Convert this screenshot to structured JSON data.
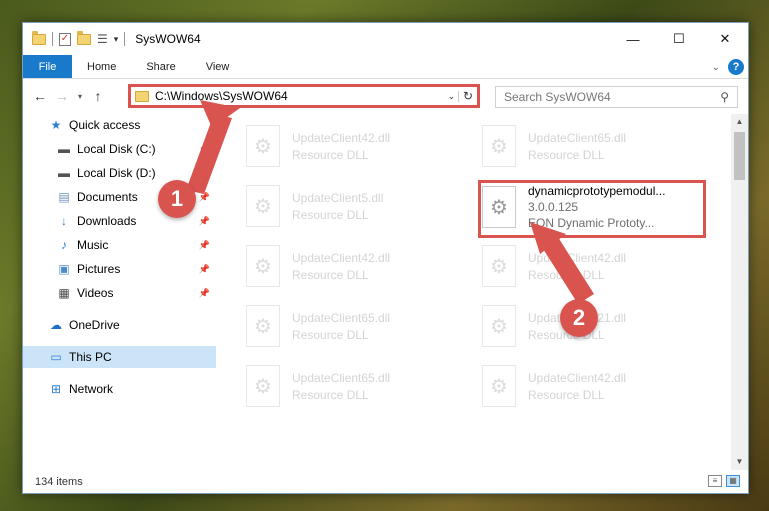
{
  "window": {
    "title": "SysWOW64",
    "controls": {
      "minimize": "—",
      "maximize": "☐",
      "close": "✕"
    }
  },
  "ribbon": {
    "tabs": [
      "File",
      "Home",
      "Share",
      "View"
    ]
  },
  "nav": {
    "address": "C:\\Windows\\SysWOW64",
    "search_placeholder": "Search SysWOW64"
  },
  "sidebar": {
    "items": [
      {
        "label": "Quick access",
        "icon": "star-icon"
      },
      {
        "label": "Local Disk (C:)",
        "icon": "drive-icon",
        "pinned": true
      },
      {
        "label": "Local Disk (D:)",
        "icon": "drive-icon",
        "pinned": true
      },
      {
        "label": "Documents",
        "icon": "documents-icon",
        "pinned": true
      },
      {
        "label": "Downloads",
        "icon": "download-icon",
        "pinned": true
      },
      {
        "label": "Music",
        "icon": "music-icon",
        "pinned": true
      },
      {
        "label": "Pictures",
        "icon": "pictures-icon",
        "pinned": true
      },
      {
        "label": "Videos",
        "icon": "videos-icon",
        "pinned": true
      },
      {
        "label": "OneDrive",
        "icon": "cloud-icon"
      },
      {
        "label": "This PC",
        "icon": "computer-icon",
        "selected": true
      },
      {
        "label": "Network",
        "icon": "network-icon"
      }
    ]
  },
  "files": {
    "left": [
      {
        "name": "UpdateClient42.dll",
        "type": "Resource DLL"
      },
      {
        "name": "UpdateClient5.dll",
        "type": "Resource DLL"
      },
      {
        "name": "UpdateClient42.dll",
        "type": "Resource DLL"
      },
      {
        "name": "UpdateClient65.dll",
        "type": "Resource DLL"
      },
      {
        "name": "UpdateClient65.dll",
        "type": "Resource DLL"
      }
    ],
    "right": [
      {
        "name": "UpdateClient65.dll",
        "type": "Resource DLL"
      },
      {
        "name": "dynamicprototypemodul...",
        "type": "3.0.0.125",
        "desc": "EON Dynamic Prototy...",
        "highlighted": true
      },
      {
        "name": "UpdateClient42.dll",
        "type": "Resource DLL"
      },
      {
        "name": "UpdateClient21.dll",
        "type": "Resource DLL"
      },
      {
        "name": "UpdateClient42.dll",
        "type": "Resource DLL"
      }
    ]
  },
  "status": {
    "count": "134 items"
  },
  "annotations": {
    "step1": "1",
    "step2": "2",
    "color": "#d9534f"
  }
}
